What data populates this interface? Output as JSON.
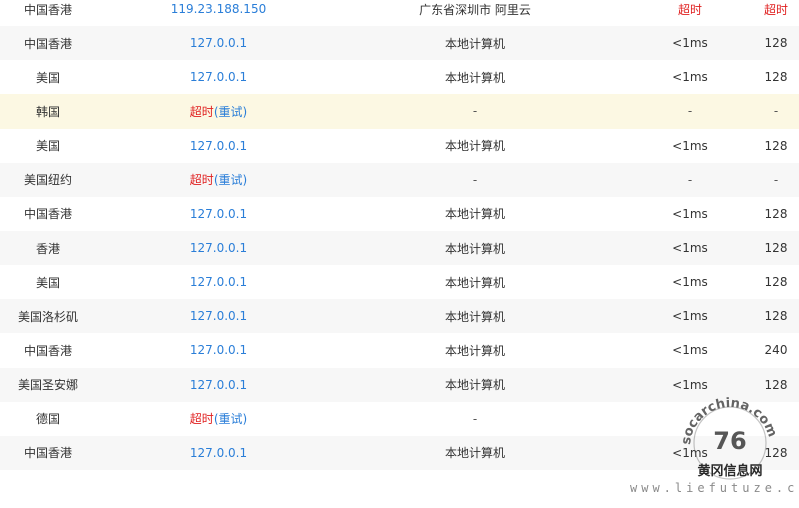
{
  "rows": [
    {
      "location": "中国香港",
      "ip": "119.23.188.150",
      "isp": "广东省深圳市 阿里云",
      "time": "超时",
      "ttl": "超时",
      "style": "white",
      "partial": true
    },
    {
      "location": "中国香港",
      "ip": "127.0.0.1",
      "isp": "本地计算机",
      "time": "<1ms",
      "ttl": "128",
      "style": "alt"
    },
    {
      "location": "美国",
      "ip": "127.0.0.1",
      "isp": "本地计算机",
      "time": "<1ms",
      "ttl": "128",
      "style": "white"
    },
    {
      "location": "韩国",
      "timeout_label": "超时",
      "retry_label": "(重试)",
      "isp": "-",
      "time": "-",
      "ttl": "-",
      "style": "hl"
    },
    {
      "location": "美国",
      "ip": "127.0.0.1",
      "isp": "本地计算机",
      "time": "<1ms",
      "ttl": "128",
      "style": "white"
    },
    {
      "location": "美国纽约",
      "timeout_label": "超时",
      "retry_label": "(重试)",
      "isp": "-",
      "time": "-",
      "ttl": "-",
      "style": "alt"
    },
    {
      "location": "中国香港",
      "ip": "127.0.0.1",
      "isp": "本地计算机",
      "time": "<1ms",
      "ttl": "128",
      "style": "white"
    },
    {
      "location": "香港",
      "ip": "127.0.0.1",
      "isp": "本地计算机",
      "time": "<1ms",
      "ttl": "128",
      "style": "alt"
    },
    {
      "location": "美国",
      "ip": "127.0.0.1",
      "isp": "本地计算机",
      "time": "<1ms",
      "ttl": "128",
      "style": "white"
    },
    {
      "location": "美国洛杉矶",
      "ip": "127.0.0.1",
      "isp": "本地计算机",
      "time": "<1ms",
      "ttl": "128",
      "style": "alt"
    },
    {
      "location": "中国香港",
      "ip": "127.0.0.1",
      "isp": "本地计算机",
      "time": "<1ms",
      "ttl": "240",
      "style": "white"
    },
    {
      "location": "美国圣安娜",
      "ip": "127.0.0.1",
      "isp": "本地计算机",
      "time": "<1ms",
      "ttl": "128",
      "style": "alt"
    },
    {
      "location": "德国",
      "timeout_label": "超时",
      "retry_label": "(重试)",
      "isp": "-",
      "time": "",
      "ttl": "",
      "style": "white"
    },
    {
      "location": "中国香港",
      "ip": "127.0.0.1",
      "isp": "本地计算机",
      "time": "<1ms",
      "ttl": "128",
      "style": "alt",
      "partial": true
    }
  ],
  "watermark": {
    "circle_text": "socarchina.com",
    "brand": "黄冈信息网",
    "url": "www.liefutuze.com",
    "number": "76"
  },
  "colors": {
    "link": "#2a7ed8",
    "timeout": "#e02020",
    "row_alt": "#f7f7f7",
    "row_highlight": "#fcf8e3"
  }
}
